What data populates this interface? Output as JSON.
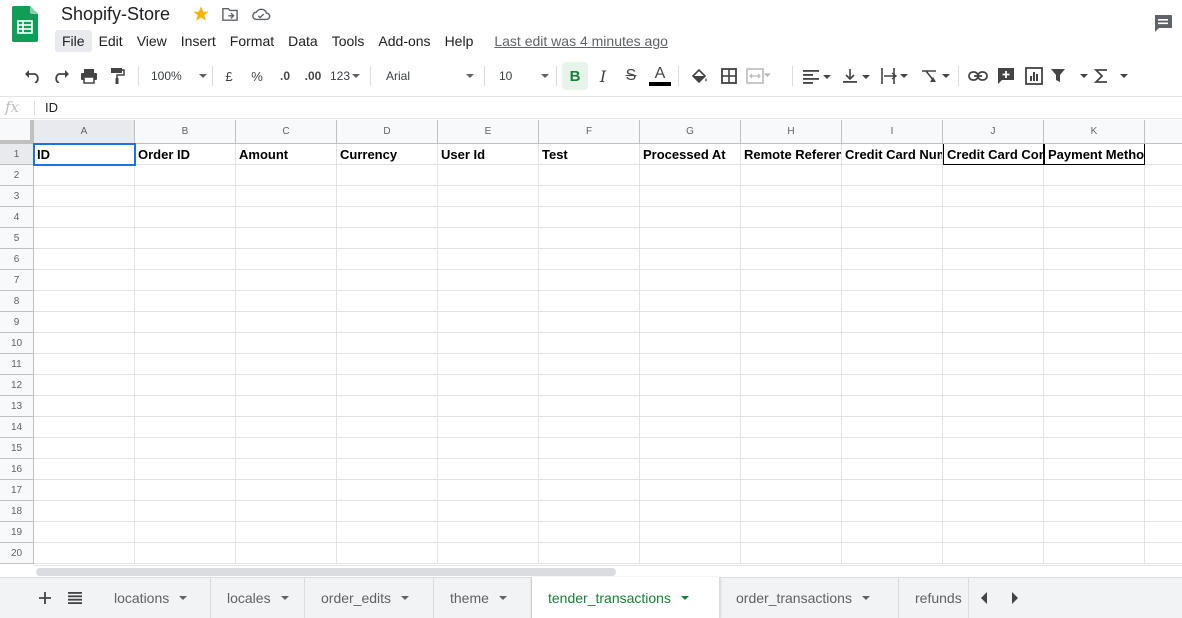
{
  "doc": {
    "title": "Shopify-Store",
    "last_edit": "Last edit was 4 minutes ago"
  },
  "menu": [
    "File",
    "Edit",
    "View",
    "Insert",
    "Format",
    "Data",
    "Tools",
    "Add-ons",
    "Help"
  ],
  "toolbar": {
    "zoom": "100%",
    "currency": "£",
    "percent": "%",
    "decrease_decimal": ".0",
    "increase_decimal": ".00",
    "more_formats": "123",
    "font": "Arial",
    "font_size": "10",
    "bold": "B",
    "italic": "I",
    "strikethrough": "S",
    "text_color": "A"
  },
  "formula_bar": {
    "fx": "fx",
    "value": "ID"
  },
  "grid": {
    "columns": [
      "A",
      "B",
      "C",
      "D",
      "E",
      "F",
      "G",
      "H",
      "I",
      "J",
      "K"
    ],
    "rows": [
      "1",
      "2",
      "3",
      "4",
      "5",
      "6",
      "7",
      "8",
      "9",
      "10",
      "11",
      "12",
      "13",
      "14",
      "15",
      "16",
      "17",
      "18",
      "19",
      "20"
    ],
    "header_row": [
      "ID",
      "Order ID",
      "Amount",
      "Currency",
      "User Id",
      "Test",
      "Processed At",
      "Remote Reference",
      "Credit Card Number",
      "Credit Card Company",
      "Payment Method"
    ]
  },
  "sheets": {
    "tabs": [
      "locations",
      "locales",
      "order_edits",
      "theme",
      "tender_transactions",
      "order_transactions",
      "refunds"
    ],
    "active": "tender_transactions"
  },
  "colors": {
    "accent_green": "#188038",
    "selection_blue": "#1a73e8",
    "star_yellow": "#f4b400"
  }
}
